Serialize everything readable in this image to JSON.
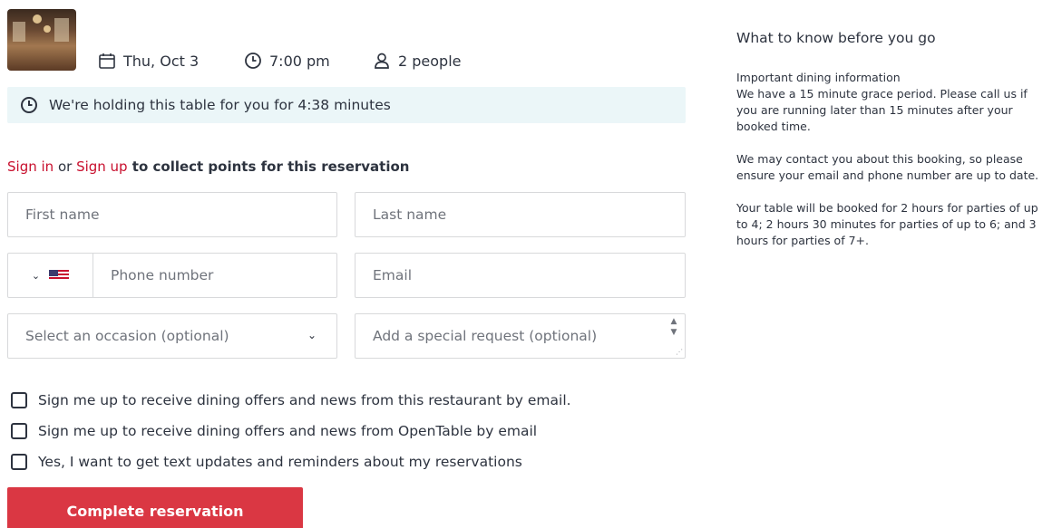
{
  "reservation": {
    "date": "Thu, Oct 3",
    "time": "7:00 pm",
    "party": "2 people"
  },
  "hold_message": "We're holding this table for you for 4:38 minutes",
  "signin": {
    "sign_in": "Sign in",
    "or": " or ",
    "sign_up": "Sign up",
    "rest": " to collect points for this reservation"
  },
  "form": {
    "first_name": "First name",
    "last_name": "Last name",
    "phone": "Phone number",
    "email": "Email",
    "occasion": "Select an occasion (optional)",
    "special_request": "Add a special request (optional)"
  },
  "checkboxes": [
    "Sign me up to receive dining offers and news from this restaurant by email.",
    "Sign me up to receive dining offers and news from OpenTable by email",
    "Yes, I want to get text updates and reminders about my reservations"
  ],
  "cta": "Complete reservation",
  "aside": {
    "title": "What to know before you go",
    "subtitle": "Important dining information",
    "paragraphs": [
      "We have a 15 minute grace period. Please call us if you are running later than 15 minutes after your booked time.",
      "We may contact you about this booking, so please ensure your email and phone number are up to date.",
      "Your table will be booked for 2 hours for parties of up to 4; 2 hours 30 minutes for parties of up to 6; and 3 hours for parties of 7+."
    ]
  },
  "colors": {
    "accent": "#da3743",
    "link": "#c8102e",
    "hold_bg": "#ebf6f8"
  }
}
